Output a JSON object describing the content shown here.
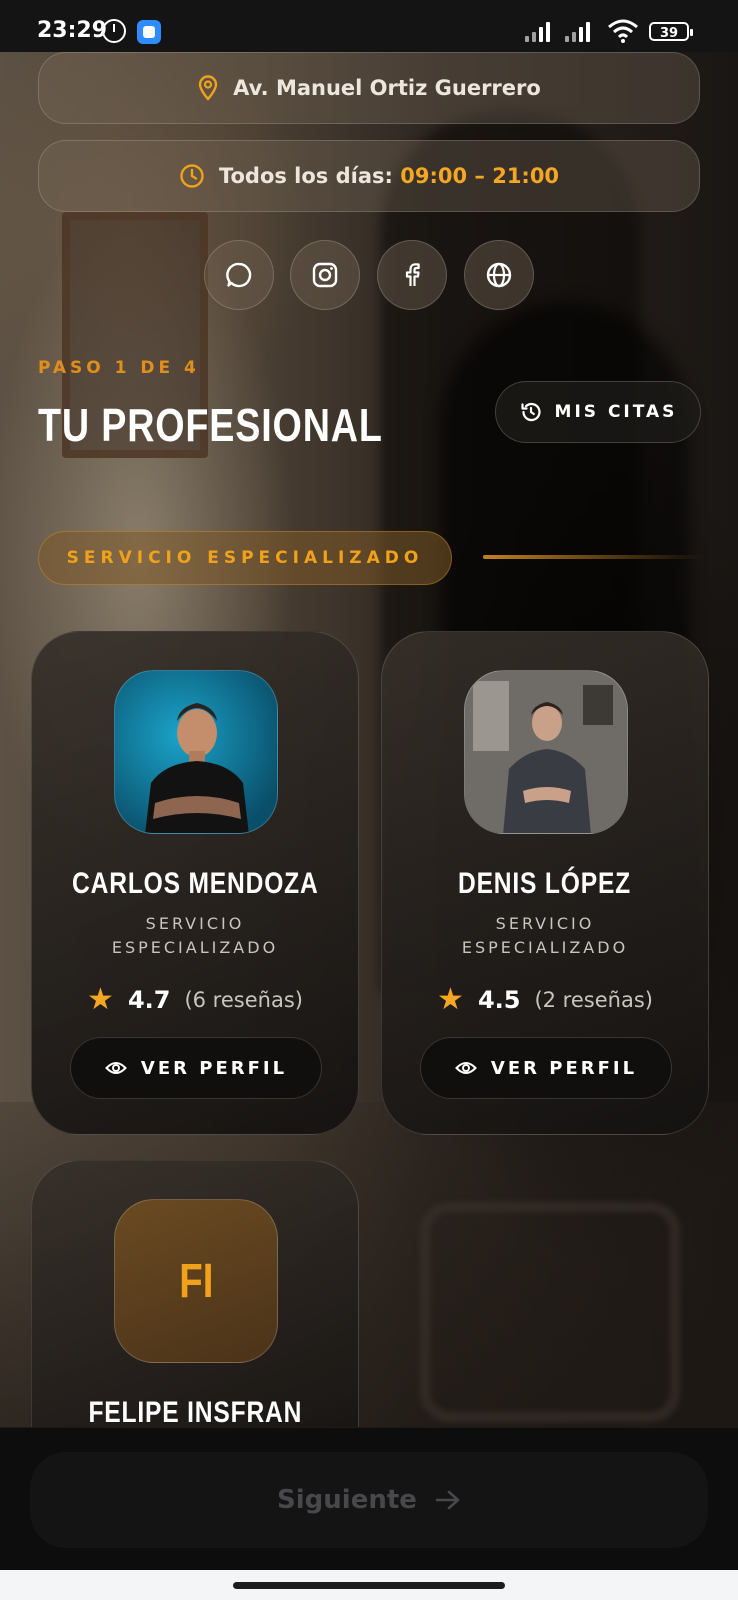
{
  "status_bar": {
    "time": "23:29",
    "battery": "39"
  },
  "location": {
    "address": "Av. Manuel Ortiz Guerrero"
  },
  "hours": {
    "label": "Todos los días:",
    "value": "09:00 – 21:00"
  },
  "social": [
    "whatsapp-icon",
    "instagram-icon",
    "facebook-icon",
    "web-icon"
  ],
  "wizard": {
    "step": "PASO 1 DE 4",
    "title": "TU PROFESIONAL",
    "mis_citas": "MIS CITAS"
  },
  "section": {
    "label": "SERVICIO ESPECIALIZADO"
  },
  "professionals": [
    {
      "name": "CARLOS MENDOZA",
      "role": "SERVICIO ESPECIALIZADO",
      "rating": "4.7",
      "reviews": "(6 reseñas)",
      "button": "VER PERFIL"
    },
    {
      "name": "DENIS LÓPEZ",
      "role": "SERVICIO ESPECIALIZADO",
      "rating": "4.5",
      "reviews": "(2 reseñas)",
      "button": "VER PERFIL"
    },
    {
      "name": "FELIPE INSFRAN",
      "initials": "FI"
    }
  ],
  "footer": {
    "next": "Siguiente"
  },
  "colors": {
    "accent": "#f5a623",
    "background": "#1a1512"
  }
}
